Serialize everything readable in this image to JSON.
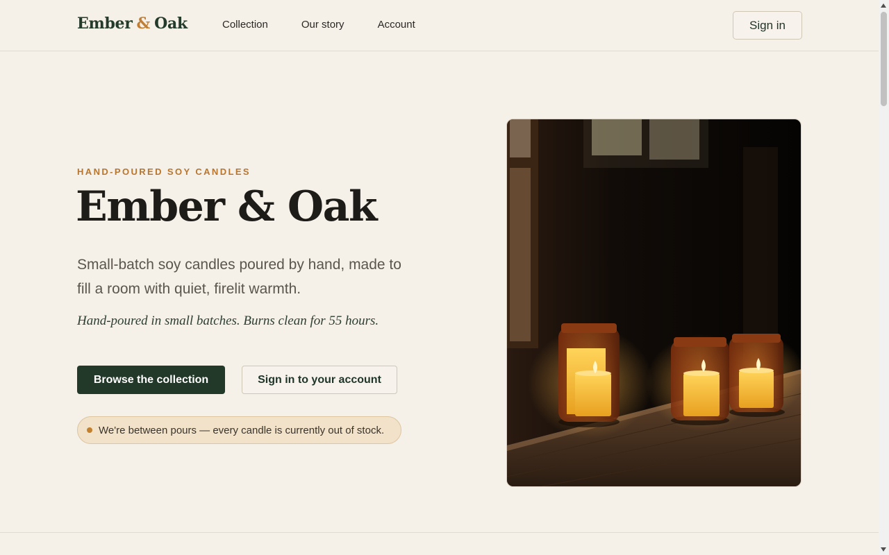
{
  "header": {
    "logo": {
      "word1": "Ember",
      "amp": "&",
      "word2": "Oak"
    },
    "nav": [
      {
        "label": "Collection"
      },
      {
        "label": "Our story"
      },
      {
        "label": "Account"
      }
    ],
    "signin_label": "Sign in"
  },
  "hero": {
    "eyebrow": "HAND-POURED SOY CANDLES",
    "title": "Ember & Oak",
    "description": "Small-batch soy candles poured by hand, made to fill a room with quiet, firelit warmth.",
    "tagline": "Hand-poured in small batches. Burns clean for 55 hours.",
    "primary_button": "Browse the collection",
    "secondary_button": "Sign in to your account",
    "stock_notice": "We're between pours — every candle is currently out of stock."
  },
  "colors": {
    "background": "#f5f0e8",
    "brand_green": "#223828",
    "accent_amber": "#c17f36",
    "notice_bg": "#f1e2c9"
  },
  "icons": [
    "status-dot-icon",
    "scroll-up-arrow-icon",
    "scroll-down-arrow-icon"
  ]
}
